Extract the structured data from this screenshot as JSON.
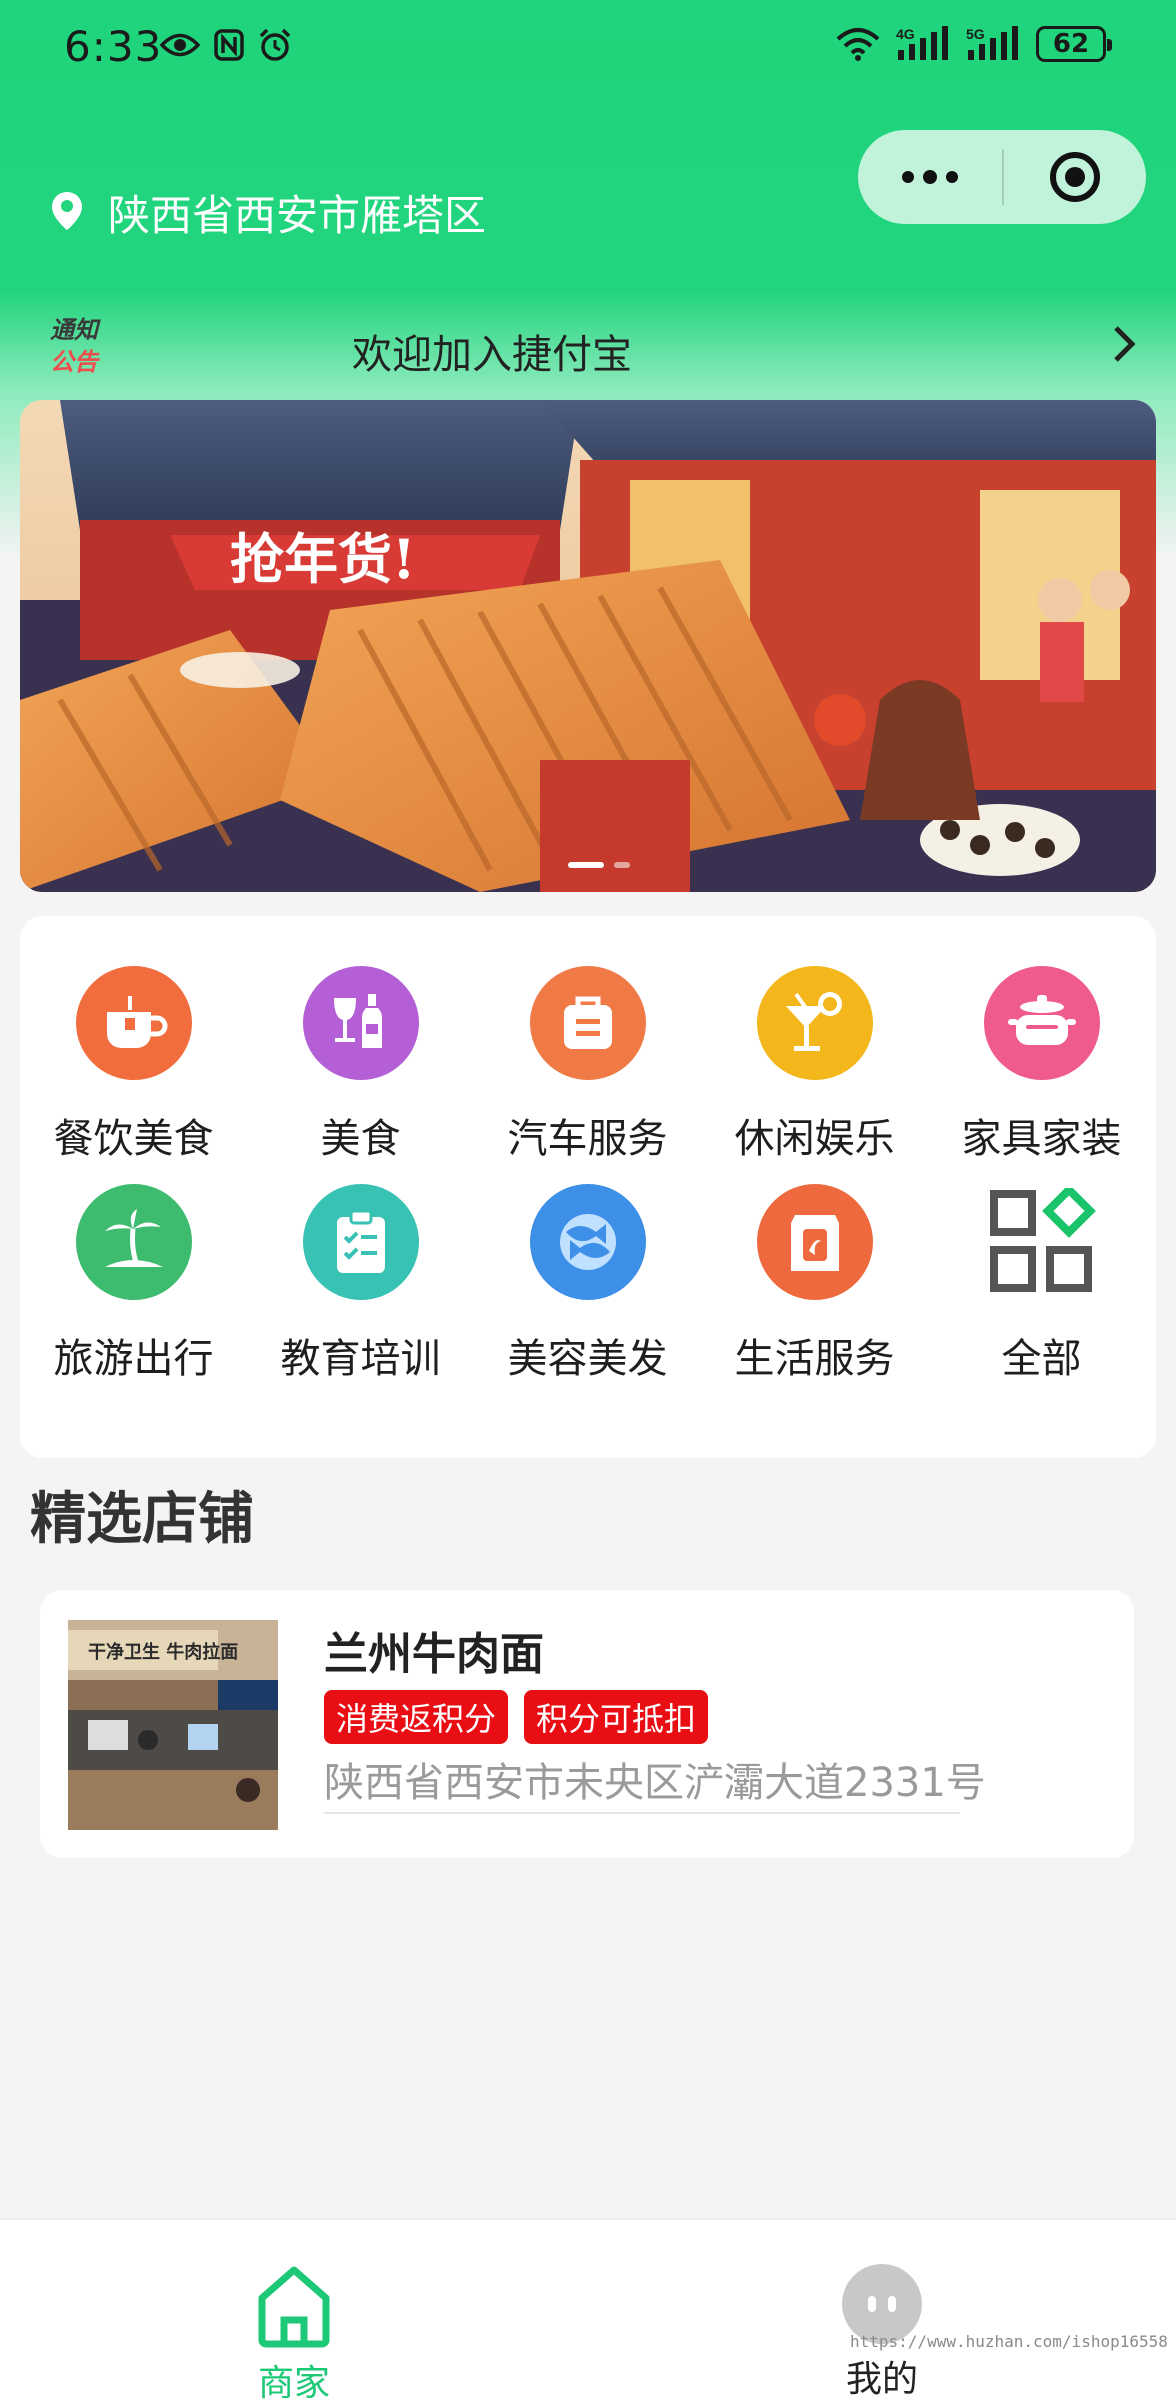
{
  "status_bar": {
    "time": "6:33",
    "battery": "62",
    "net1": "4G",
    "net2": "5G"
  },
  "header": {
    "location": "陕西省西安市雁塔区"
  },
  "notice": {
    "badge_line1": "通知",
    "badge_line2": "公告",
    "text": "欢迎加入捷付宝"
  },
  "banner": {
    "sign_text": "抢年货!",
    "slides": 2,
    "active_slide": 0
  },
  "categories": [
    {
      "label": "餐饮美食",
      "icon": "cafe-icon",
      "color": "#f26d3d"
    },
    {
      "label": "美食",
      "icon": "wine-icon",
      "color": "#b45fd6"
    },
    {
      "label": "汽车服务",
      "icon": "bag-icon",
      "color": "#f07a45"
    },
    {
      "label": "休闲娱乐",
      "icon": "cocktail-icon",
      "color": "#f3b71b"
    },
    {
      "label": "家具家装",
      "icon": "pot-icon",
      "color": "#ef5b8c"
    },
    {
      "label": "旅游出行",
      "icon": "palm-island-icon",
      "color": "#3dbb6e"
    },
    {
      "label": "教育培训",
      "icon": "clipboard-icon",
      "color": "#38c2b4"
    },
    {
      "label": "美容美发",
      "icon": "fish-icon",
      "color": "#3d8fe8"
    },
    {
      "label": "生活服务",
      "icon": "package-icon",
      "color": "#ee6a3e"
    },
    {
      "label": "全部",
      "icon": "grid-icon",
      "color": "#19c46a"
    }
  ],
  "section": {
    "title": "精选店铺"
  },
  "stores": [
    {
      "name": "兰州牛肉面",
      "tags": [
        "消费返积分",
        "积分可抵扣"
      ],
      "address": "陕西省西安市未央区浐灞大道2331号",
      "thumb_sign": "干净卫生 牛肉拉面"
    }
  ],
  "tabbar": {
    "home": "商家",
    "mine": "我的"
  },
  "watermark": "https://www.huzhan.com/ishop16558",
  "colors": {
    "brand": "#1fd47c",
    "tab_active": "#1dc876",
    "tag": "#e80e14"
  }
}
